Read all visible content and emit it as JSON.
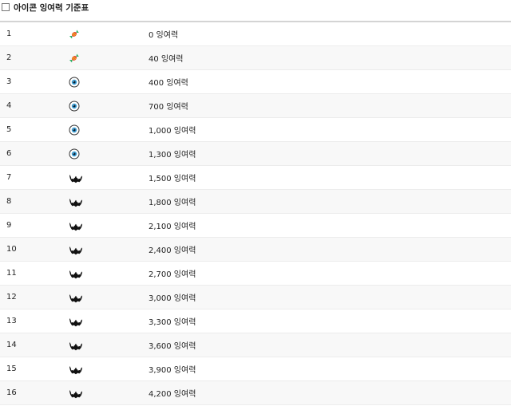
{
  "header": {
    "title": "아이콘 잉여력 기준표"
  },
  "rows": [
    {
      "rank": "1",
      "icon": "candy-icon",
      "value": "0 잉여력"
    },
    {
      "rank": "2",
      "icon": "candy-icon",
      "value": "40 잉여력"
    },
    {
      "rank": "3",
      "icon": "eyeball-icon",
      "value": "400 잉여력"
    },
    {
      "rank": "4",
      "icon": "eyeball-icon",
      "value": "700 잉여력"
    },
    {
      "rank": "5",
      "icon": "eyeball-icon",
      "value": "1,000 잉여력"
    },
    {
      "rank": "6",
      "icon": "eyeball-icon",
      "value": "1,300 잉여력"
    },
    {
      "rank": "7",
      "icon": "bat-icon",
      "value": "1,500 잉여력"
    },
    {
      "rank": "8",
      "icon": "bat-icon",
      "value": "1,800 잉여력"
    },
    {
      "rank": "9",
      "icon": "bat-icon",
      "value": "2,100 잉여력"
    },
    {
      "rank": "10",
      "icon": "bat-icon",
      "value": "2,400 잉여력"
    },
    {
      "rank": "11",
      "icon": "bat-icon",
      "value": "2,700 잉여력"
    },
    {
      "rank": "12",
      "icon": "bat-icon",
      "value": "3,000 잉여력"
    },
    {
      "rank": "13",
      "icon": "bat-icon",
      "value": "3,300 잉여력"
    },
    {
      "rank": "14",
      "icon": "bat-icon",
      "value": "3,600 잉여력"
    },
    {
      "rank": "15",
      "icon": "bat-icon",
      "value": "3,900 잉여력"
    },
    {
      "rank": "16",
      "icon": "bat-icon",
      "value": "4,200 잉여력"
    }
  ]
}
